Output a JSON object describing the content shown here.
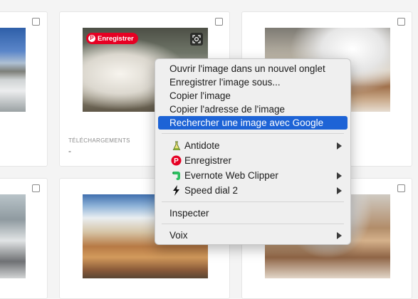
{
  "pinterest_badge": {
    "label": "Enregistrer"
  },
  "card_meta": {
    "downloads_label": "TÉLÉCHARGEMENTS",
    "downloads_value": "-"
  },
  "context_menu": {
    "items": [
      {
        "label": "Ouvrir l'image dans un nouvel onglet"
      },
      {
        "label": "Enregistrer l'image sous..."
      },
      {
        "label": "Copier l'image"
      },
      {
        "label": "Copier l'adresse de l'image"
      },
      {
        "label": "Rechercher une image avec Google",
        "highlighted": true
      }
    ],
    "extensions": [
      {
        "label": "Antidote",
        "icon": "flask-icon",
        "submenu": true
      },
      {
        "label": "Enregistrer",
        "icon": "pinterest-icon",
        "submenu": false
      },
      {
        "label": "Evernote Web Clipper",
        "icon": "evernote-icon",
        "submenu": true
      },
      {
        "label": "Speed dial 2",
        "icon": "lightning-icon",
        "submenu": true
      }
    ],
    "inspect": {
      "label": "Inspecter"
    },
    "voice": {
      "label": "Voix",
      "submenu": true
    }
  },
  "colors": {
    "highlight": "#1d63d6",
    "pinterest_red": "#e60023",
    "evernote_green": "#2dbe60"
  }
}
